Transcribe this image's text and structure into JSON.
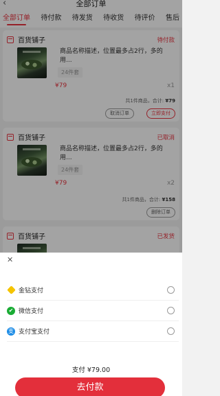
{
  "header": {
    "back_icon": "chevron-left-icon",
    "title": "全部订单"
  },
  "tabs": [
    "全部订单",
    "待付款",
    "待发货",
    "待收货",
    "待评价",
    "售后"
  ],
  "orders": [
    {
      "shop": "百货铺子",
      "status": "待付款",
      "product": "商品名称描述，位置最多占2行，多的用...",
      "spec": "24件套",
      "price": "¥79",
      "qty": "x1",
      "summary_prefix": "共1件商品，合计: ",
      "summary_total": "¥79",
      "buttons": [
        "取消订单",
        "立即支付"
      ]
    },
    {
      "shop": "百货铺子",
      "status": "已取消",
      "product": "商品名称描述，位置最多占2行，多的用...",
      "spec": "24件套",
      "price": "¥79",
      "qty": "x2",
      "summary_prefix": "共1件商品，合计: ",
      "summary_total": "¥158",
      "buttons": [
        "删除订单"
      ]
    },
    {
      "shop": "百货铺子",
      "status": "已发货"
    }
  ],
  "payment": {
    "close_icon": "close-icon",
    "methods": [
      {
        "label": "金钻支付",
        "icon": "diamond-icon"
      },
      {
        "label": "微信支付",
        "icon": "wechat-icon"
      },
      {
        "label": "支付宝支付",
        "icon": "alipay-icon"
      }
    ],
    "amount": "支付 ¥79.00",
    "pay_button": "去付款"
  },
  "colors": {
    "accent": "#e9333f",
    "wechat": "#19ac34",
    "alipay": "#1e8de6",
    "gold": "#f5c400"
  }
}
